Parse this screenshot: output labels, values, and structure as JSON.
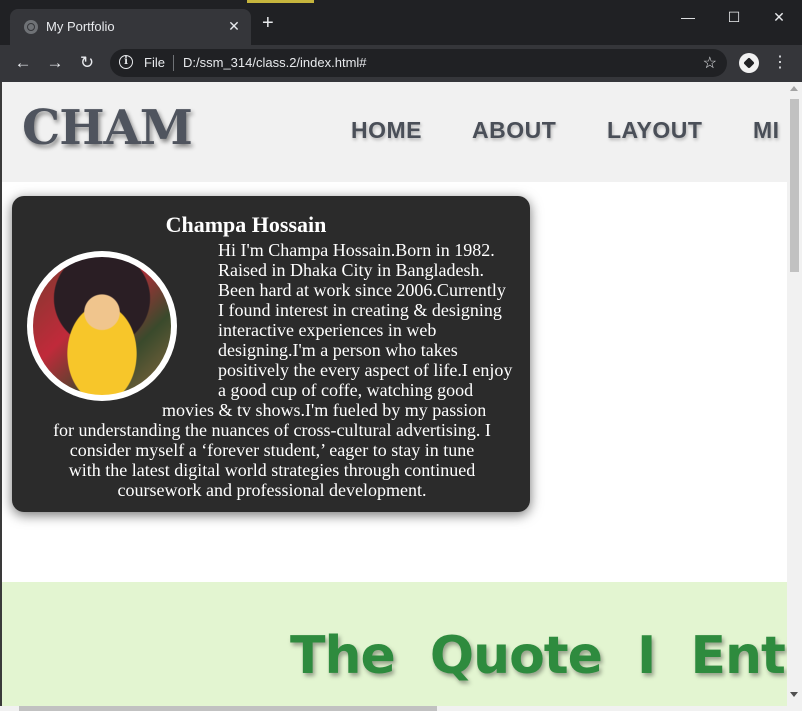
{
  "browser": {
    "tab_title": "My Portfolio",
    "tab_close": "✕",
    "new_tab": "+",
    "window_controls": {
      "minimize": "—",
      "maximize": "☐",
      "close": "✕"
    },
    "nav": {
      "back": "←",
      "forward": "→",
      "reload": "↻"
    },
    "address_scheme": "File",
    "address_url": "D:/ssm_314/class.2/index.html#",
    "bookmark": "☆",
    "menu": "⋮"
  },
  "header": {
    "logo": "CHAM",
    "nav_items": [
      "HOME",
      "ABOUT",
      "LAYOUT",
      "MI"
    ]
  },
  "profile": {
    "name": "Champa Hossain",
    "bio_lines": [
      "Hi I'm Champa Hossain.Born in 1982.",
      "Raised in Dhaka City in Bangladesh.",
      "Been hard at work since 2006.Currently",
      "I found interest in creating & designing",
      "interactive experiences in web",
      "designing.I'm a person who takes",
      "positively the every aspect of life.I enjoy",
      "a good cup of coffe, watching good",
      "movies & tv shows.I'm fueled by my passion",
      "for understanding the nuances of cross-cultural advertising. I",
      "consider myself a ‘forever student,’ eager to stay in tune",
      "with the latest digital world strategies through continued",
      "coursework and professional development."
    ]
  },
  "quote": {
    "heading": "The Quote I Entirely"
  }
}
